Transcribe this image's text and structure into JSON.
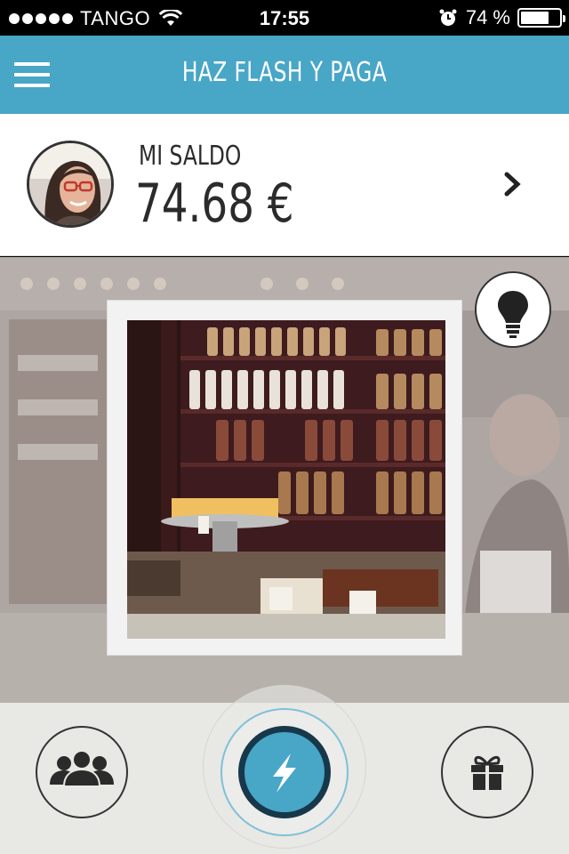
{
  "status_bar": {
    "carrier": "TANGO",
    "time": "17:55",
    "battery_percent_label": "74 %",
    "battery_level": 0.74,
    "icons": [
      "signal-dots",
      "wifi-icon",
      "alarm-icon",
      "battery-icon"
    ]
  },
  "nav": {
    "title": "HAZ FLASH Y PAGA",
    "menu_icon": "hamburger-menu-icon",
    "color": "#48a6c7"
  },
  "balance": {
    "label": "MI SALDO",
    "amount": "74.68 €",
    "chevron_icon": "chevron-right-icon"
  },
  "camera": {
    "bulb_icon": "lightbulb-icon",
    "photo_subject": "bakery-shop-photo"
  },
  "bottom_bar": {
    "buttons": [
      {
        "icon": "group-icon"
      },
      {
        "icon": "flash-icon"
      },
      {
        "icon": "gift-icon"
      }
    ],
    "accent": "#48a6c7",
    "dark": "#17384a"
  }
}
